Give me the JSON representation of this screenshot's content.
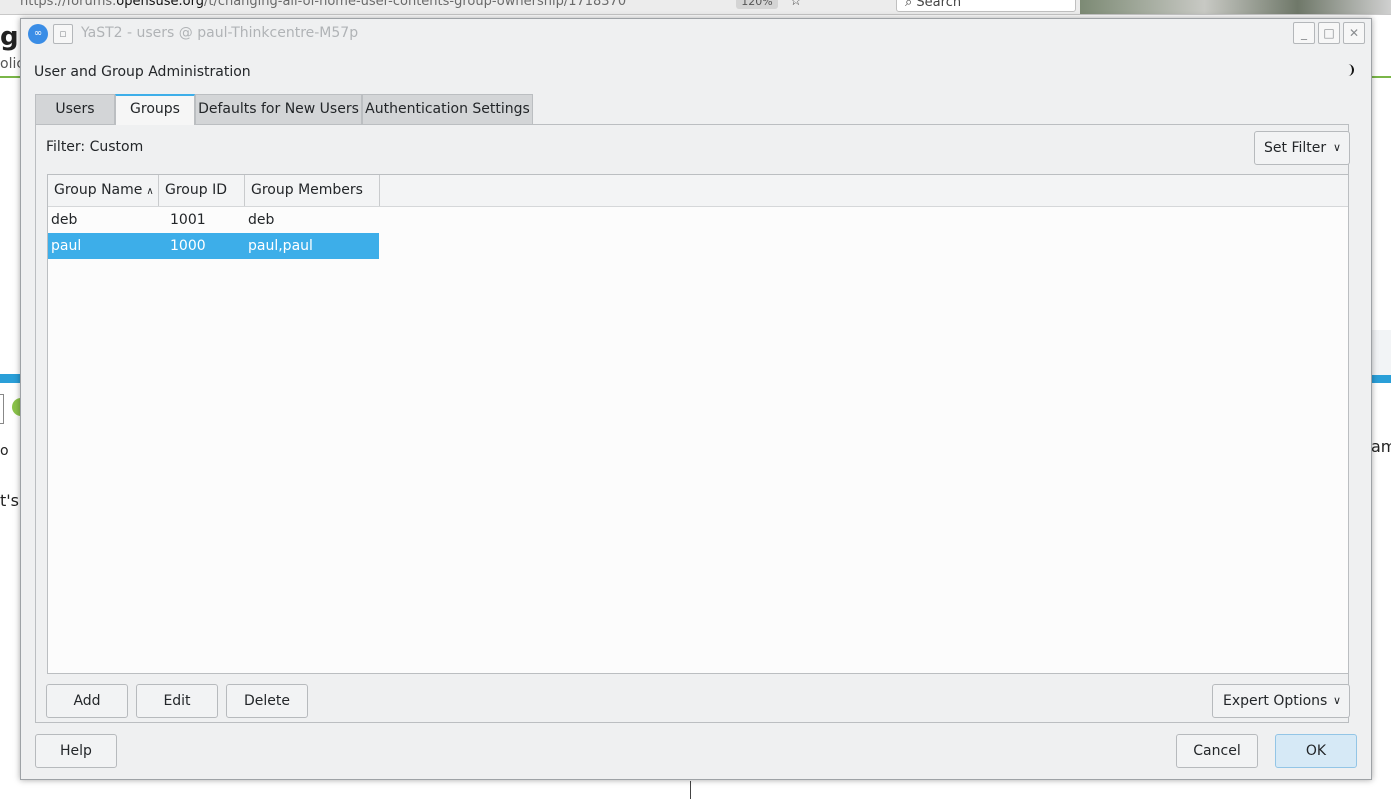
{
  "background": {
    "url_prefix": "https://forums.",
    "url_domain": "opensuse.org",
    "url_path": "/t/changing-all-of-home-user-contents-group-ownership/1718370",
    "zoom": "120%",
    "search": "Search",
    "frag_g": "g",
    "frag_lic": "olic",
    "frag_ts": "t's",
    "frag_o": "o",
    "frag_am": "am"
  },
  "window": {
    "title": "YaST2 - users @ paul-Thinkcentre-M57p",
    "section_title": "User and Group Administration"
  },
  "tabs": [
    {
      "label": "Users"
    },
    {
      "label": "Groups"
    },
    {
      "label": "Defaults for New Users"
    },
    {
      "label": "Authentication Settings"
    }
  ],
  "filter": {
    "label": "Filter: Custom",
    "set_filter_label": "Set Filter"
  },
  "table": {
    "columns": [
      "Group Name",
      "Group ID",
      "Group Members"
    ],
    "rows": [
      {
        "name": "deb",
        "gid": "1001",
        "members": "deb"
      },
      {
        "name": "paul",
        "gid": "1000",
        "members": "paul,paul"
      }
    ]
  },
  "buttons": {
    "add": "Add",
    "edit": "Edit",
    "delete": "Delete",
    "expert_options": "Expert Options",
    "help": "Help",
    "cancel": "Cancel",
    "ok": "OK"
  },
  "colors": {
    "accent": "#3daee9",
    "window_bg": "#eff0f1"
  }
}
